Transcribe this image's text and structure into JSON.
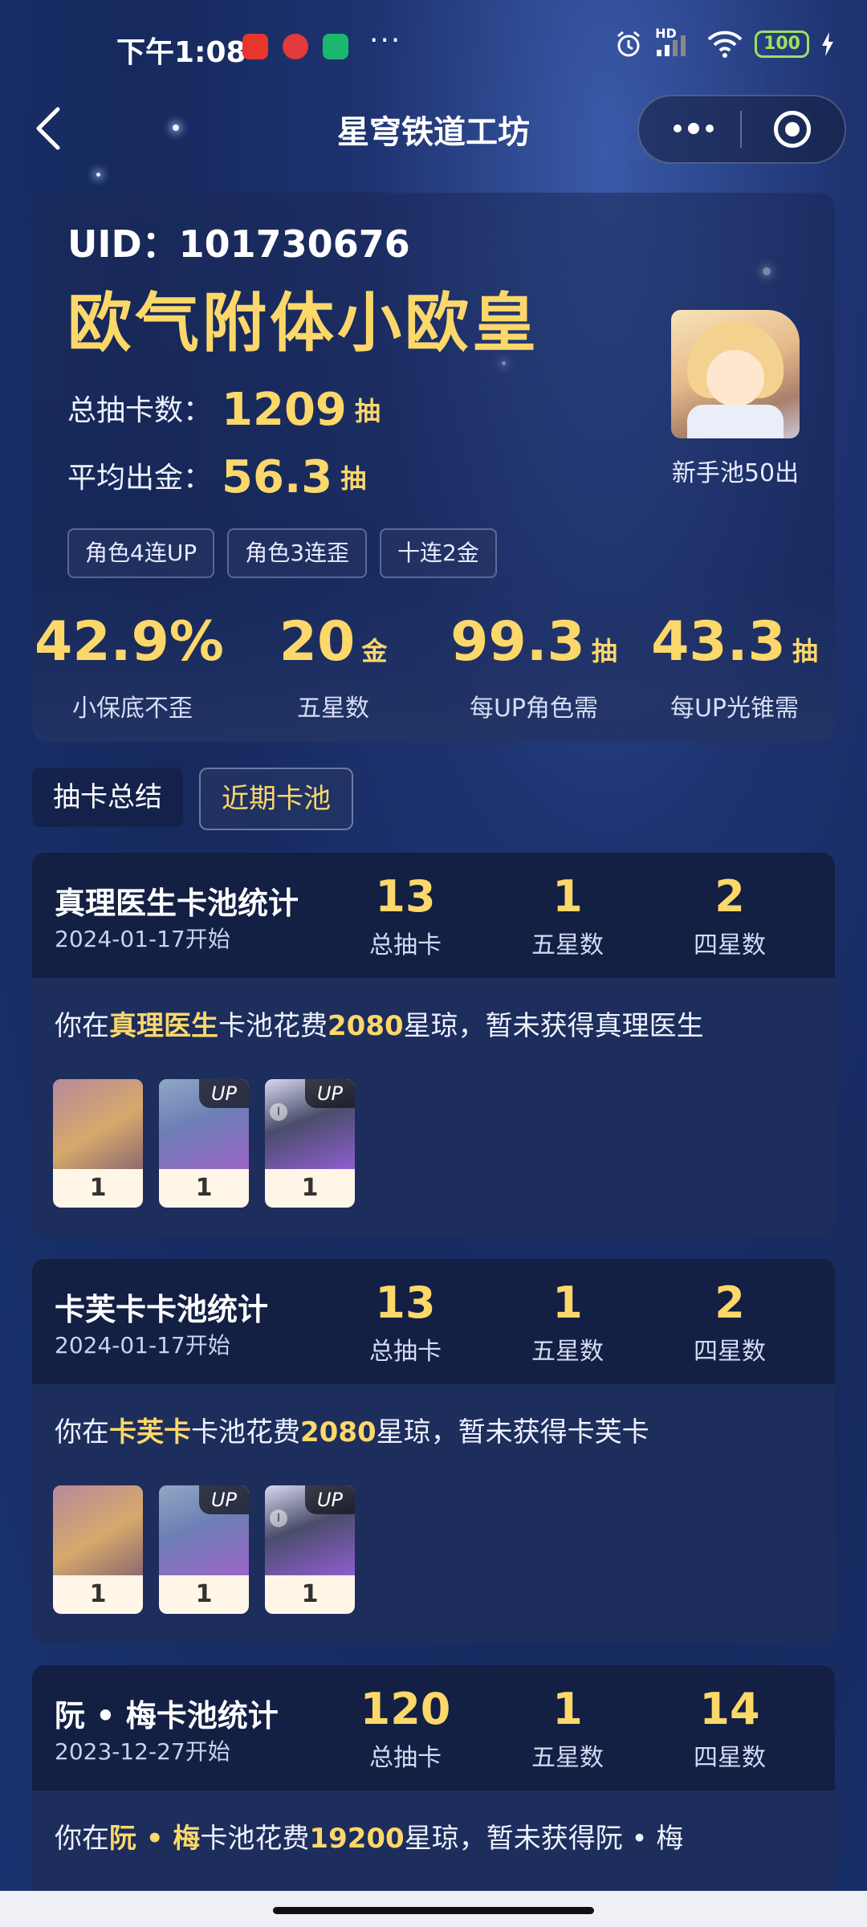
{
  "status_bar": {
    "time": "下午1:08",
    "app_icons": [
      "taobao-icon",
      "pdd-icon",
      "shield-app-icon"
    ],
    "more": "···",
    "hd": "HD",
    "battery": "100"
  },
  "nav": {
    "title": "星穹铁道工坊"
  },
  "profile": {
    "uid": "UID：101730676",
    "rank_title": "欧气附体小欧皇",
    "total_pulls_label": "总抽卡数：",
    "total_pulls_value": "1209",
    "total_pulls_unit": "抽",
    "avg_label": "平均出金：",
    "avg_value": "56.3",
    "avg_unit": "抽",
    "tags": [
      "角色4连UP",
      "角色3连歪",
      "十连2金"
    ],
    "avatar_caption": "新手池50出",
    "stats": [
      {
        "value": "42.9%",
        "unit": "",
        "label": "小保底不歪"
      },
      {
        "value": "20",
        "unit": "金",
        "label": "五星数"
      },
      {
        "value": "99.3",
        "unit": "抽",
        "label": "每UP角色需"
      },
      {
        "value": "43.3",
        "unit": "抽",
        "label": "每UP光锥需"
      }
    ]
  },
  "tabs": [
    {
      "label": "抽卡总结",
      "active": false
    },
    {
      "label": "近期卡池",
      "active": true
    }
  ],
  "pools": [
    {
      "name": "真理医生卡池统计",
      "date": "2024-01-17开始",
      "total": "13",
      "total_label": "总抽卡",
      "five": "1",
      "five_label": "五星数",
      "four": "2",
      "four_label": "四星数",
      "sentence": {
        "pre": "你在",
        "name": "真理医生",
        "mid": "卡池花费",
        "cost": "2080",
        "post": "星琼，暂未获得真理医生"
      },
      "chars": [
        {
          "count": "1",
          "up": "",
          "style": "gold"
        },
        {
          "count": "1",
          "up": "UP",
          "style": "purple"
        },
        {
          "count": "1",
          "up": "UP",
          "style": "purple2"
        }
      ]
    },
    {
      "name": "卡芙卡卡池统计",
      "date": "2024-01-17开始",
      "total": "13",
      "total_label": "总抽卡",
      "five": "1",
      "five_label": "五星数",
      "four": "2",
      "four_label": "四星数",
      "sentence": {
        "pre": "你在",
        "name": "卡芙卡",
        "mid": "卡池花费",
        "cost": "2080",
        "post": "星琼，暂未获得卡芙卡"
      },
      "chars": [
        {
          "count": "1",
          "up": "",
          "style": "gold"
        },
        {
          "count": "1",
          "up": "UP",
          "style": "purple"
        },
        {
          "count": "1",
          "up": "UP",
          "style": "purple2"
        }
      ]
    },
    {
      "name": "阮 • 梅卡池统计",
      "date": "2023-12-27开始",
      "total": "120",
      "total_label": "总抽卡",
      "five": "1",
      "five_label": "五星数",
      "four": "14",
      "four_label": "四星数",
      "sentence": {
        "pre": "你在",
        "name": "阮 • 梅",
        "mid": "卡池花费",
        "cost": "19200",
        "post": "星琼，暂未获得阮 • 梅"
      },
      "chars": []
    }
  ]
}
